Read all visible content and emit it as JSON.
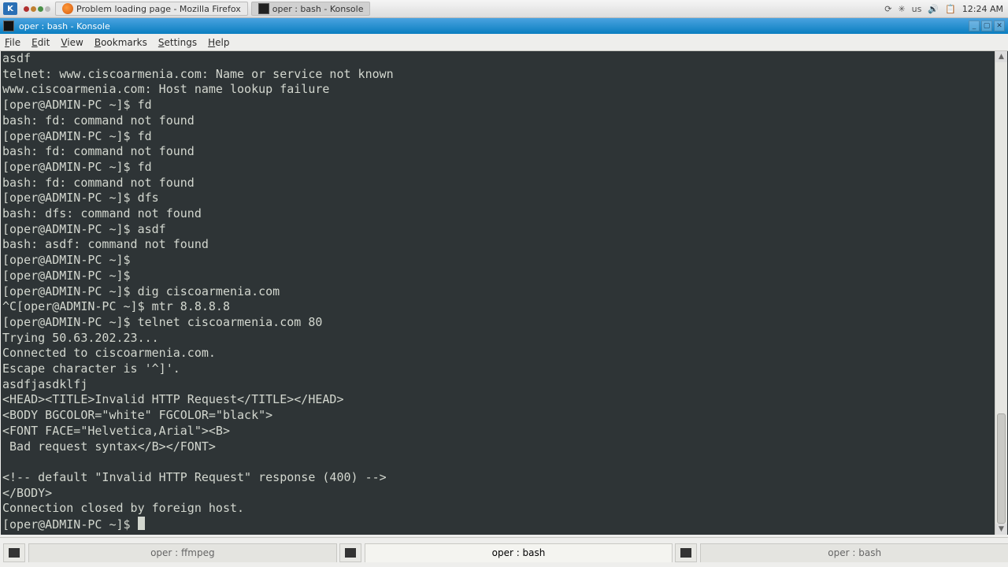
{
  "panel": {
    "task1": "Problem loading page - Mozilla Firefox",
    "task2": "oper : bash - Konsole",
    "keyboard": "us",
    "clock": "12:24 AM"
  },
  "window": {
    "title": "oper : bash - Konsole"
  },
  "menu": {
    "file": "File",
    "edit": "Edit",
    "view": "View",
    "bookmarks": "Bookmarks",
    "settings": "Settings",
    "help": "Help"
  },
  "terminal": {
    "lines": [
      "asdf",
      "telnet: www.ciscoarmenia.com: Name or service not known",
      "www.ciscoarmenia.com: Host name lookup failure",
      "[oper@ADMIN-PC ~]$ fd",
      "bash: fd: command not found",
      "[oper@ADMIN-PC ~]$ fd",
      "bash: fd: command not found",
      "[oper@ADMIN-PC ~]$ fd",
      "bash: fd: command not found",
      "[oper@ADMIN-PC ~]$ dfs",
      "bash: dfs: command not found",
      "[oper@ADMIN-PC ~]$ asdf",
      "bash: asdf: command not found",
      "[oper@ADMIN-PC ~]$ ",
      "[oper@ADMIN-PC ~]$ ",
      "[oper@ADMIN-PC ~]$ dig ciscoarmenia.com",
      "^C[oper@ADMIN-PC ~]$ mtr 8.8.8.8",
      "[oper@ADMIN-PC ~]$ telnet ciscoarmenia.com 80",
      "Trying 50.63.202.23...",
      "Connected to ciscoarmenia.com.",
      "Escape character is '^]'.",
      "asdfjasdklfj",
      "<HEAD><TITLE>Invalid HTTP Request</TITLE></HEAD>",
      "<BODY BGCOLOR=\"white\" FGCOLOR=\"black\">",
      "<FONT FACE=\"Helvetica,Arial\"><B>",
      " Bad request syntax</B></FONT>",
      "",
      "<!-- default \"Invalid HTTP Request\" response (400) -->",
      "</BODY>",
      "Connection closed by foreign host.",
      "[oper@ADMIN-PC ~]$ "
    ]
  },
  "tabs": {
    "t1": "oper : ffmpeg",
    "t2": "oper : bash",
    "t3": "oper : bash"
  }
}
